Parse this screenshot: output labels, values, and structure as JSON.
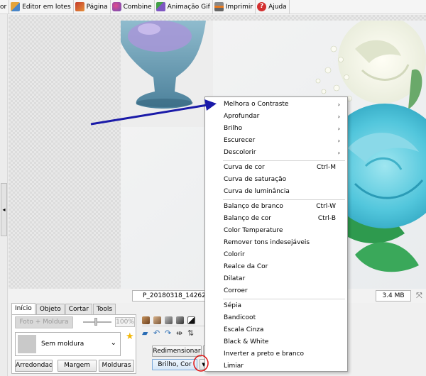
{
  "toolbar": {
    "items": [
      {
        "label": "or",
        "icon": ""
      },
      {
        "label": "Editor em lotes",
        "icon": "batch-editor-icon"
      },
      {
        "label": "Página",
        "icon": "page-icon"
      },
      {
        "label": "Combine",
        "icon": "combine-icon"
      },
      {
        "label": "Animação Gif",
        "icon": "gif-animation-icon"
      },
      {
        "label": "Imprimir",
        "icon": "print-icon"
      },
      {
        "label": "Ajuda",
        "icon": "help-icon"
      }
    ],
    "help_glyph": "?"
  },
  "status": {
    "filename": "P_20180318_142628_",
    "filesize": "3.4 MB"
  },
  "tabs": [
    "Início",
    "Objeto",
    "Cortar",
    "Tools"
  ],
  "panel": {
    "photo_frame_button": "Foto + Moldura",
    "zoom_percent": "100%",
    "frame_select": "Sem moldura",
    "arredondado": "Arredondado",
    "margem": "Margem",
    "molduras": "Molduras",
    "redimensionar": "Redimensionar",
    "brilho_cor": "Brilho, Cor"
  },
  "menu": {
    "items": [
      {
        "label": "Melhora o Contraste",
        "shortcut": "",
        "submenu": true
      },
      {
        "label": "Aprofundar",
        "shortcut": "",
        "submenu": true
      },
      {
        "label": "Brilho",
        "shortcut": "",
        "submenu": true
      },
      {
        "label": "Escurecer",
        "shortcut": "",
        "submenu": true
      },
      {
        "label": "Descolorir",
        "shortcut": "",
        "submenu": true
      },
      {
        "label": "Curva de cor",
        "shortcut": "Ctrl-M",
        "submenu": false
      },
      {
        "label": "Curva de saturação",
        "shortcut": "",
        "submenu": false
      },
      {
        "label": "Curva de luminância",
        "shortcut": "",
        "submenu": false
      },
      {
        "label": "Balanço de branco",
        "shortcut": "Ctrl-W",
        "submenu": false
      },
      {
        "label": "Balanço de cor",
        "shortcut": "Ctrl-B",
        "submenu": false
      },
      {
        "label": "Color Temperature",
        "shortcut": "",
        "submenu": false
      },
      {
        "label": "Remover tons indesejáveis",
        "shortcut": "",
        "submenu": false
      },
      {
        "label": "Colorir",
        "shortcut": "",
        "submenu": false
      },
      {
        "label": "Realce da Cor",
        "shortcut": "",
        "submenu": false
      },
      {
        "label": "Dilatar",
        "shortcut": "",
        "submenu": false
      },
      {
        "label": "Corroer",
        "shortcut": "",
        "submenu": false
      },
      {
        "label": "Sépia",
        "shortcut": "",
        "submenu": false
      },
      {
        "label": "Bandicoot",
        "shortcut": "",
        "submenu": false
      },
      {
        "label": "Escala Cinza",
        "shortcut": "",
        "submenu": false
      },
      {
        "label": "Black & White",
        "shortcut": "",
        "submenu": false
      },
      {
        "label": "Inverter a preto e branco",
        "shortcut": "",
        "submenu": false
      },
      {
        "label": "Limiar",
        "shortcut": "",
        "submenu": false
      }
    ],
    "submenu_arrow": "›"
  },
  "colors": {
    "annotation_arrow": "#1a1aa8",
    "annotation_circle": "#e01010",
    "menu_border": "#9a9a9a"
  }
}
